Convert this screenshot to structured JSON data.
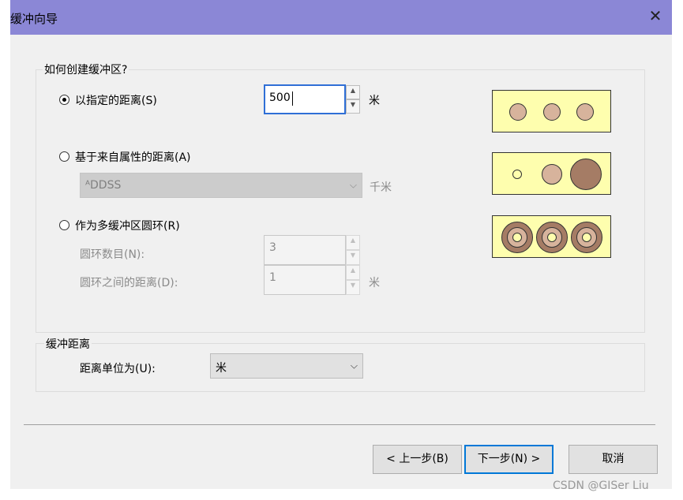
{
  "window": {
    "title": "缓冲向导",
    "close_glyph": "✕"
  },
  "main_group": {
    "label": "如何创建缓冲区?",
    "option_distance": {
      "label": "以指定的距离(S)",
      "value": "500",
      "unit": "米",
      "selected": true
    },
    "option_attribute": {
      "label": "基于来自属性的距离(A)",
      "field": "ᴬDDSS",
      "unit": "千米",
      "selected": false
    },
    "option_rings": {
      "label": "作为多缓冲区圆环(R)",
      "selected": false,
      "ring_count_label": "圆环数目(N):",
      "ring_count": "3",
      "ring_distance_label": "圆环之间的距离(D):",
      "ring_distance": "1",
      "ring_distance_unit": "米"
    }
  },
  "buffer_group": {
    "label": "缓冲距离",
    "unit_label": "距离单位为(U):",
    "unit_value": "米"
  },
  "buttons": {
    "back": "< 上一步(B)",
    "next": "下一步(N) >",
    "cancel": "取消"
  },
  "watermark": "CSDN @GISer Liu",
  "icons": {
    "spin_up": "▲",
    "spin_down": "▼",
    "dropdown": "⌵"
  },
  "colors": {
    "title_bar": "#8b87d6",
    "preview_bg": "#fefeae",
    "circle_fill": "#d7b39c",
    "circle_dark": "#a57c65",
    "focus": "#2f6fd6"
  }
}
